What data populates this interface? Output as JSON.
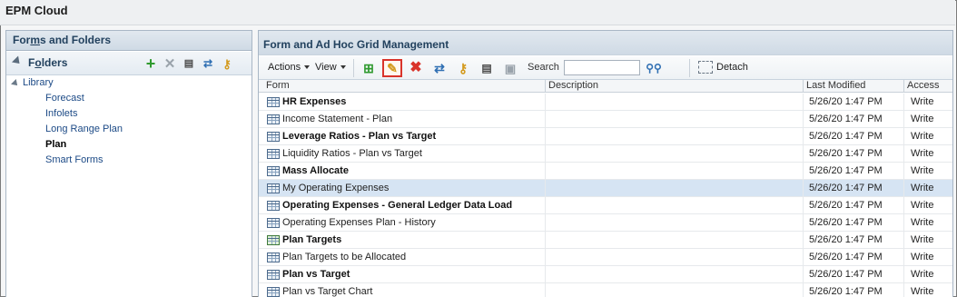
{
  "app": {
    "title": "EPM Cloud"
  },
  "left_panel": {
    "title_prefix": "For",
    "title_underlined": "m",
    "title_suffix": "s and Folders",
    "folders_prefix": "F",
    "folders_underlined": "o",
    "folders_suffix": "lders",
    "icons": [
      "add-folder-icon",
      "delete-folder-icon",
      "rename-folder-icon",
      "move-folder-icon",
      "assign-access-icon"
    ],
    "tree": {
      "root": "Library",
      "children": [
        "Forecast",
        "Infolets",
        "Long Range Plan",
        "Plan",
        "Smart Forms"
      ],
      "selected": "Plan"
    }
  },
  "right_panel": {
    "title": "Form and Ad Hoc Grid Management",
    "toolbar": {
      "actions_label": "Actions",
      "view_label": "View",
      "search_label": "Search",
      "search_value": "",
      "detach_label": "Detach",
      "highlighted_icon": "edit-pencil-icon"
    },
    "columns": [
      "Form",
      "Description",
      "Last Modified",
      "Access"
    ],
    "rows": [
      {
        "name": "HR Expenses",
        "description": "",
        "modified": "5/26/20 1:47 PM",
        "access": "Write",
        "bold": true
      },
      {
        "name": "Income Statement - Plan",
        "description": "",
        "modified": "5/26/20 1:47 PM",
        "access": "Write",
        "bold": false
      },
      {
        "name": "Leverage Ratios - Plan vs Target",
        "description": "",
        "modified": "5/26/20 1:47 PM",
        "access": "Write",
        "bold": true
      },
      {
        "name": "Liquidity Ratios - Plan vs Target",
        "description": "",
        "modified": "5/26/20 1:47 PM",
        "access": "Write",
        "bold": false
      },
      {
        "name": "Mass Allocate",
        "description": "",
        "modified": "5/26/20 1:47 PM",
        "access": "Write",
        "bold": true
      },
      {
        "name": "My Operating Expenses",
        "description": "",
        "modified": "5/26/20 1:47 PM",
        "access": "Write",
        "bold": false,
        "selected": true
      },
      {
        "name": "Operating Expenses - General Ledger Data Load",
        "description": "",
        "modified": "5/26/20 1:47 PM",
        "access": "Write",
        "bold": true
      },
      {
        "name": "Operating Expenses Plan - History",
        "description": "",
        "modified": "5/26/20 1:47 PM",
        "access": "Write",
        "bold": false
      },
      {
        "name": "Plan Targets",
        "description": "",
        "modified": "5/26/20 1:47 PM",
        "access": "Write",
        "bold": true,
        "icon": "green"
      },
      {
        "name": "Plan Targets to be Allocated",
        "description": "",
        "modified": "5/26/20 1:47 PM",
        "access": "Write",
        "bold": false
      },
      {
        "name": "Plan vs Target",
        "description": "",
        "modified": "5/26/20 1:47 PM",
        "access": "Write",
        "bold": true
      },
      {
        "name": "Plan vs Target Chart",
        "description": "",
        "modified": "5/26/20 1:47 PM",
        "access": "Write",
        "bold": false
      }
    ]
  }
}
